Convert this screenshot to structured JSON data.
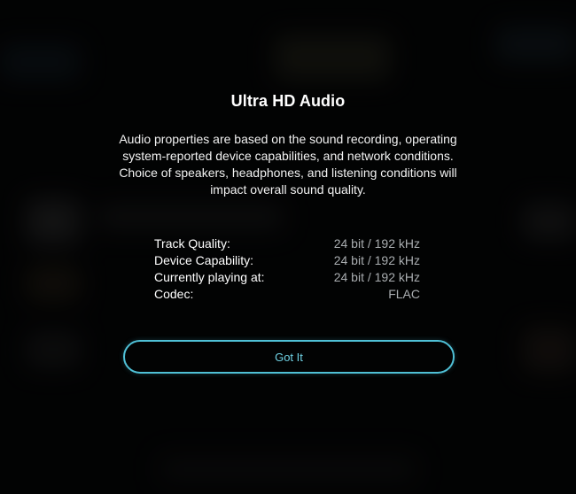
{
  "dialog": {
    "title": "Ultra HD Audio",
    "description": "Audio properties are based on the sound recording, operating system-reported device capabilities, and network conditions. Choice of speakers, headphones, and listening conditions will impact overall sound quality.",
    "properties": [
      {
        "label": "Track Quality:",
        "value": "24 bit / 192 kHz"
      },
      {
        "label": "Device Capability:",
        "value": "24 bit / 192 kHz"
      },
      {
        "label": "Currently playing at:",
        "value": "24 bit / 192 kHz"
      },
      {
        "label": "Codec:",
        "value": "FLAC"
      }
    ],
    "button_label": "Got It"
  },
  "colors": {
    "accent": "#4fc0d6",
    "background": "#060708",
    "value_text": "#a9adb0"
  }
}
